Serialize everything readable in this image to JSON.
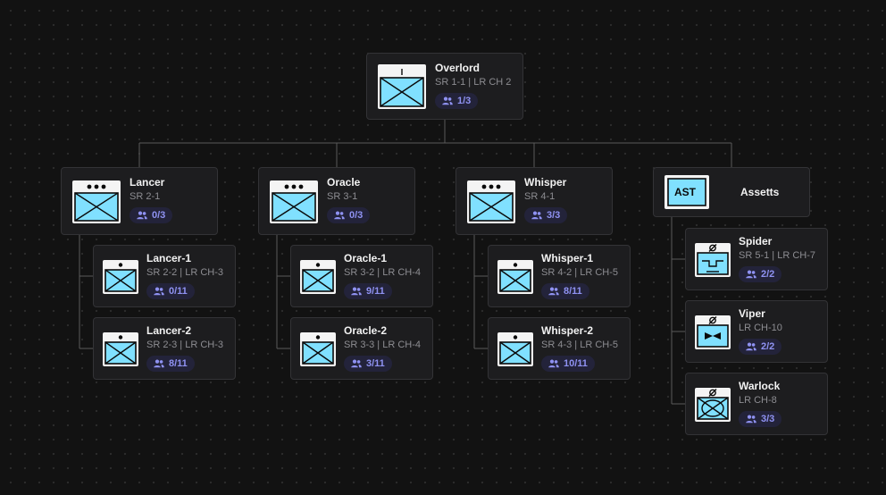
{
  "colors": {
    "background": "#121212",
    "card": "#1d1d1f",
    "card_border": "#333336",
    "connector": "#5a5a5a",
    "symbol_fill": "#80e0ff",
    "badge_text": "#8f92f2"
  },
  "root": {
    "name": "Overlord",
    "sub": "SR 1-1 | LR CH 2",
    "count": "1/3",
    "symbol": "headquarters-symbol-icon"
  },
  "groups": [
    {
      "name": "Lancer",
      "sub": "SR 2-1",
      "count": "0/3",
      "symbol": "platoon-symbol-icon",
      "children": [
        {
          "name": "Lancer-1",
          "sub": "SR 2-2 | LR CH-3",
          "count": "0/11",
          "symbol": "squad-symbol-icon"
        },
        {
          "name": "Lancer-2",
          "sub": "SR 2-3 | LR CH-3",
          "count": "8/11",
          "symbol": "squad-symbol-icon"
        }
      ]
    },
    {
      "name": "Oracle",
      "sub": "SR 3-1",
      "count": "0/3",
      "symbol": "platoon-symbol-icon",
      "children": [
        {
          "name": "Oracle-1",
          "sub": "SR 3-2 | LR CH-4",
          "count": "9/11",
          "symbol": "squad-symbol-icon"
        },
        {
          "name": "Oracle-2",
          "sub": "SR 3-3 | LR CH-4",
          "count": "3/11",
          "symbol": "squad-symbol-icon"
        }
      ]
    },
    {
      "name": "Whisper",
      "sub": "SR 4-1",
      "count": "3/3",
      "symbol": "platoon-symbol-icon",
      "children": [
        {
          "name": "Whisper-1",
          "sub": "SR 4-2 | LR CH-5",
          "count": "8/11",
          "symbol": "squad-symbol-icon"
        },
        {
          "name": "Whisper-2",
          "sub": "SR 4-3 | LR CH-5",
          "count": "10/11",
          "symbol": "squad-symbol-icon"
        }
      ]
    },
    {
      "name": "Assetts",
      "symbol_text": "AST",
      "symbol": "asset-symbol-icon",
      "children": [
        {
          "name": "Spider",
          "sub": "SR 5-1 | LR CH-7",
          "count": "2/2",
          "symbol": "uav-symbol-icon"
        },
        {
          "name": "Viper",
          "sub": "LR CH-10",
          "count": "2/2",
          "symbol": "drone-symbol-icon"
        },
        {
          "name": "Warlock",
          "sub": "LR CH-8",
          "count": "3/3",
          "symbol": "armor-symbol-icon"
        }
      ]
    }
  ]
}
